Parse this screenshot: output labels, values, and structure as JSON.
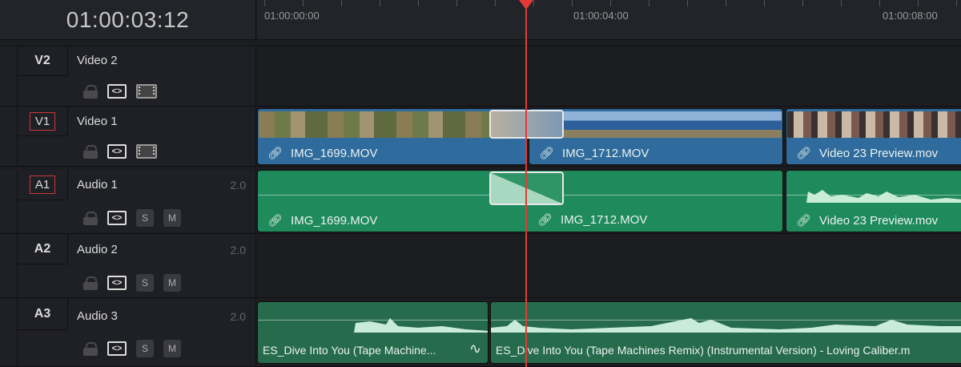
{
  "timecode": "01:00:03:12",
  "ruler": {
    "labels": [
      "01:00:00:00",
      "01:00:04:00",
      "01:00:08:00"
    ]
  },
  "tracks": [
    {
      "id": "V2",
      "name": "Video 2",
      "kind": "video",
      "selected": false
    },
    {
      "id": "V1",
      "name": "Video 1",
      "kind": "video",
      "selected": true
    },
    {
      "id": "A1",
      "name": "Audio 1",
      "kind": "audio",
      "channels": "2.0",
      "selected": true,
      "solo": "S",
      "mute": "M"
    },
    {
      "id": "A2",
      "name": "Audio 2",
      "kind": "audio",
      "channels": "2.0",
      "selected": false,
      "solo": "S",
      "mute": "M"
    },
    {
      "id": "A3",
      "name": "Audio 3",
      "kind": "audio",
      "channels": "2.0",
      "selected": false,
      "solo": "S",
      "mute": "M"
    }
  ],
  "clips": {
    "v1": [
      "IMG_1699.MOV",
      "IMG_1712.MOV",
      "Video 23 Preview.mov"
    ],
    "a1": [
      "IMG_1699.MOV",
      "IMG_1712.MOV",
      "Video 23 Preview.mov"
    ],
    "a3": [
      "ES_Dive Into You (Tape Machine...",
      "ES_Dive Into You (Tape Machines Remix) (Instrumental Version) - Loving Caliber.m"
    ]
  },
  "icons": {
    "link": "link-icon",
    "lock": "lock-icon",
    "auto_select": "auto-select-icon",
    "film": "film-icon",
    "fade": "fade-curve-icon"
  },
  "colors": {
    "video_clip": "#2f6b9c",
    "audio_clip": "#1f8a5b",
    "playhead": "#e53935",
    "selected_track": "#c8383a"
  }
}
